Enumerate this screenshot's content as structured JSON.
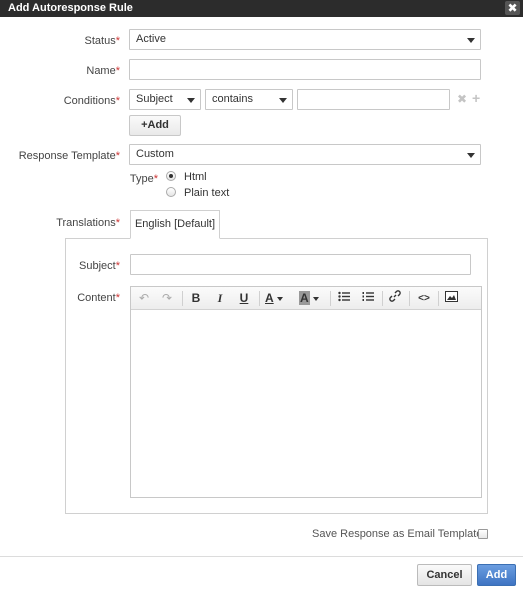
{
  "dialog": {
    "title": "Add Autoresponse Rule",
    "close_glyph": "✖"
  },
  "form": {
    "status": {
      "label": "Status",
      "value": "Active"
    },
    "name": {
      "label": "Name",
      "value": ""
    },
    "conditions": {
      "label": "Conditions",
      "field": "Subject",
      "operator": "contains",
      "value": "",
      "add_label": "+Add"
    },
    "response_template": {
      "label": "Response Template",
      "value": "Custom"
    },
    "type": {
      "label": "Type",
      "options": [
        {
          "label": "Html",
          "selected": true
        },
        {
          "label": "Plain text",
          "selected": false
        }
      ]
    },
    "translations": {
      "label": "Translations",
      "tabs": [
        {
          "label": "English [Default]"
        }
      ],
      "subject": {
        "label": "Subject",
        "value": ""
      },
      "content": {
        "label": "Content",
        "value": ""
      }
    },
    "save_as_template": {
      "label": "Save Response as Email Template",
      "checked": false
    }
  },
  "toolbar": {
    "undo": "↶",
    "redo": "↷",
    "bold": "B",
    "italic": "I",
    "underline": "U",
    "text_color": "A",
    "bg_color": "A",
    "link": "⚭",
    "source": "<>",
    "image": "▣"
  },
  "buttons": {
    "cancel": "Cancel",
    "submit": "Add"
  },
  "colors": {
    "title_bg": "#2c2c2c",
    "primary": "#3e74c3",
    "required": "#cc3333"
  }
}
